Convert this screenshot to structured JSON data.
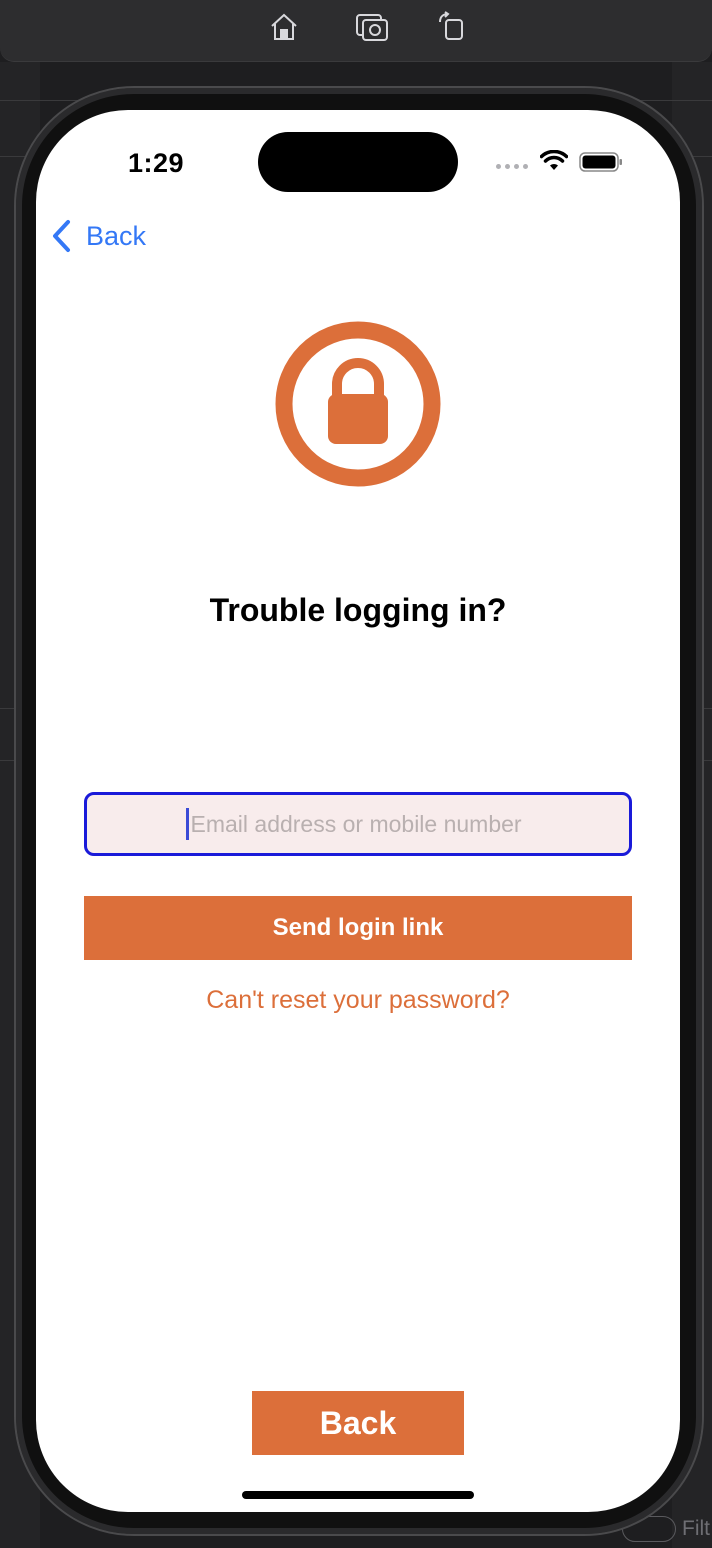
{
  "simulator": {
    "toolbar_icons": [
      "home-icon",
      "screenshot-icon",
      "rotate-icon"
    ],
    "filter_label": "Filt"
  },
  "status_bar": {
    "time": "1:29"
  },
  "nav": {
    "back_label": "Back"
  },
  "content": {
    "heading": "Trouble logging in?",
    "email_placeholder": "Email address or mobile number",
    "email_value": "",
    "send_button_label": "Send login link",
    "reset_link_label": "Can't reset your password?",
    "bottom_back_label": "Back"
  },
  "colors": {
    "accent": "#dc6f3a",
    "link_blue": "#3478f6",
    "field_focus_border": "#1a1ad9",
    "field_background": "#f8ecec"
  }
}
